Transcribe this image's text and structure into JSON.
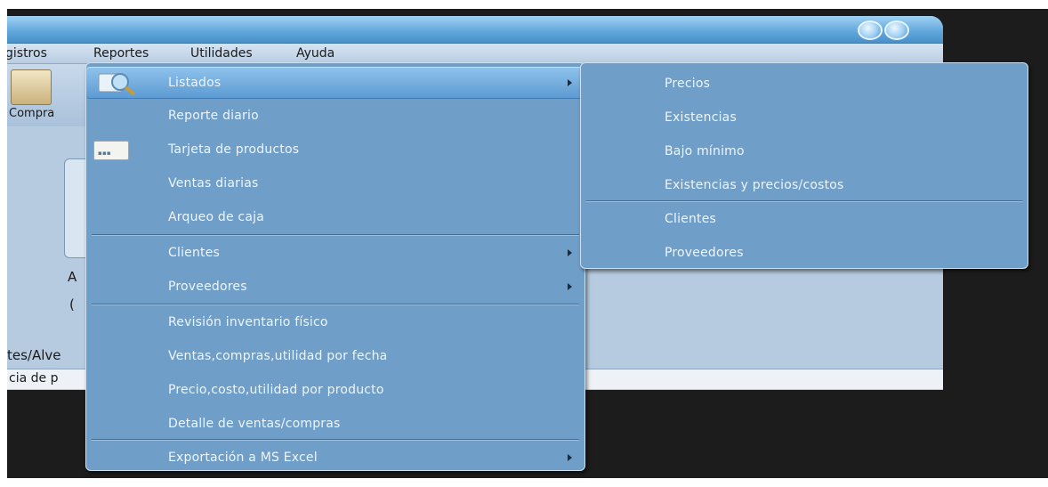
{
  "window": {
    "menubar": [
      "gistros",
      "Reportes",
      "Utilidades",
      "Ayuda"
    ],
    "toolbar_label": "Compra",
    "side_texts": [
      "A",
      "(",
      "tes/Alve"
    ],
    "status_text": "cia de p"
  },
  "menu": {
    "items": [
      {
        "label": "Listados",
        "submenu": true
      },
      {
        "label": "Reporte diario"
      },
      {
        "label": "Tarjeta de productos"
      },
      {
        "label": "Ventas diarias"
      },
      {
        "label": "Arqueo de caja"
      },
      {
        "label": "Clientes",
        "submenu": true
      },
      {
        "label": "Proveedores",
        "submenu": true
      },
      {
        "label": "Revisión inventario físico"
      },
      {
        "label": "Ventas,compras,utilidad por fecha"
      },
      {
        "label": "Precio,costo,utilidad por producto"
      },
      {
        "label": "Detalle de ventas/compras"
      },
      {
        "label": "Exportación a MS Excel",
        "submenu": true
      }
    ]
  },
  "submenu": {
    "items": [
      {
        "label": "Precios"
      },
      {
        "label": "Existencias"
      },
      {
        "label": "Bajo mínimo"
      },
      {
        "label": "Existencias y precios/costos"
      },
      {
        "label": "Clientes"
      },
      {
        "label": "Proveedores"
      }
    ]
  },
  "colors": {
    "menu_bg": "#6f9ec8",
    "highlight": "#5d9bd3",
    "text": "#eef5fc"
  }
}
